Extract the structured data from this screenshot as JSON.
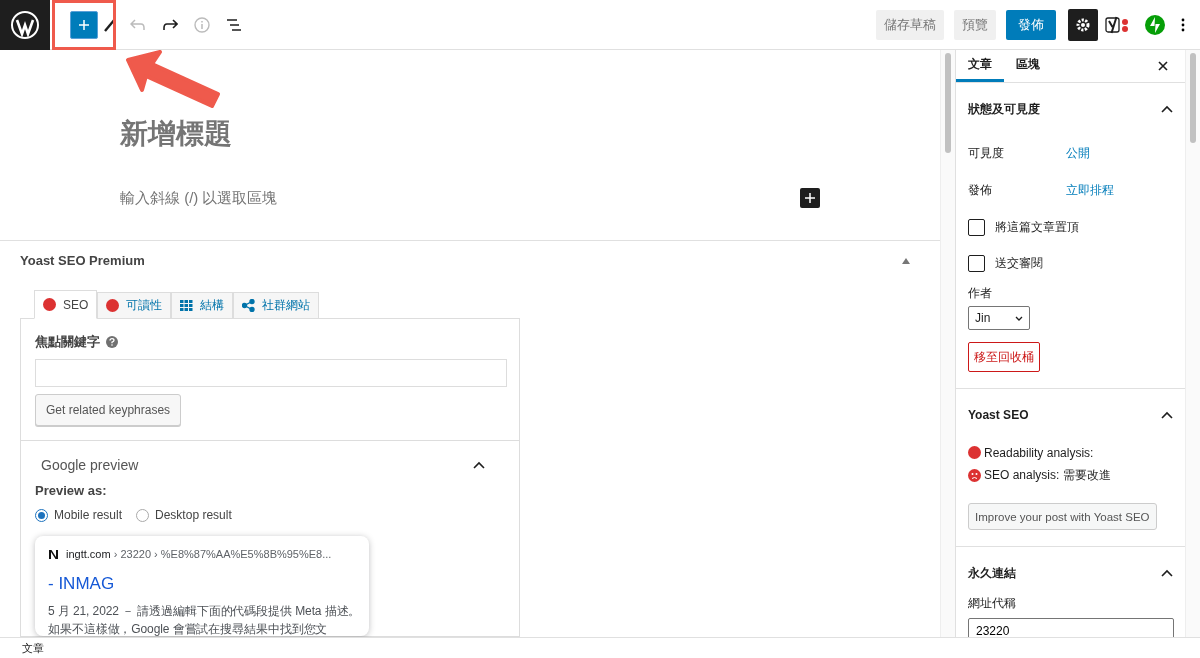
{
  "toolbar": {
    "inserter_open": false,
    "buttons": [
      {
        "label": "儲存草稿",
        "kind": "secondary"
      },
      {
        "label": "預覽",
        "kind": "secondary"
      },
      {
        "label": "發佈",
        "kind": "primary"
      }
    ],
    "settings_open": true
  },
  "editor": {
    "title_placeholder": "新增標題",
    "block_placeholder": "輸入斜線 (/) 以選取區塊"
  },
  "yoast": {
    "title": "Yoast SEO Premium",
    "expanded": true,
    "tabs": [
      {
        "label": "SEO",
        "kind": "dot",
        "selected": true
      },
      {
        "label": "可讀性",
        "kind": "dot",
        "selected": false
      },
      {
        "label": "結構",
        "kind": "grid",
        "selected": false
      },
      {
        "label": "社群網站",
        "kind": "share",
        "selected": false
      }
    ],
    "focus_keyphrase": {
      "label": "焦點關鍵字"
    },
    "related_button": "Get related keyphrases",
    "google_preview": {
      "title": "Google preview",
      "expanded": true,
      "preview_as": "Preview as:",
      "options": [
        {
          "label": "Mobile result",
          "selected": true
        },
        {
          "label": "Desktop result",
          "selected": false
        }
      ],
      "snippet": {
        "site": "ingtt.com",
        "path": "› 23220 › %E8%87%AA%E5%8B%95%E8...",
        "title": "- INMAG",
        "date": "5 月 21, 2022 －",
        "description": "請透過編輯下面的代碼段提供 Meta 描述。如果不這樣做，Google 會嘗試在搜尋結果中找到您文"
      }
    }
  },
  "sidebar": {
    "tabs": [
      {
        "label": "文章",
        "selected": true
      },
      {
        "label": "區塊",
        "selected": false
      }
    ],
    "status_panel": {
      "title": "狀態及可見度",
      "expanded": true,
      "rows": [
        {
          "label": "可見度",
          "value": "公開"
        },
        {
          "label": "發佈",
          "value": "立即排程"
        }
      ],
      "checkboxes": [
        {
          "label": "將這篇文章置頂",
          "checked": false
        },
        {
          "label": "送交審閱",
          "checked": false
        }
      ],
      "author_label": "作者",
      "author": "Jin",
      "trash_button": "移至回收桶"
    },
    "yoast_panel": {
      "title": "Yoast SEO",
      "expanded": true,
      "analyses": [
        {
          "label": "Readability analysis:",
          "kind": "dot"
        },
        {
          "label": "SEO analysis: 需要改進",
          "kind": "sad"
        }
      ],
      "button": "Improve your post with Yoast SEO"
    },
    "permalink_panel": {
      "title": "永久連結",
      "expanded": true,
      "slug_label": "網址代稱",
      "slug": "23220"
    }
  },
  "status_bar": {
    "breadcrumb": "文章"
  }
}
